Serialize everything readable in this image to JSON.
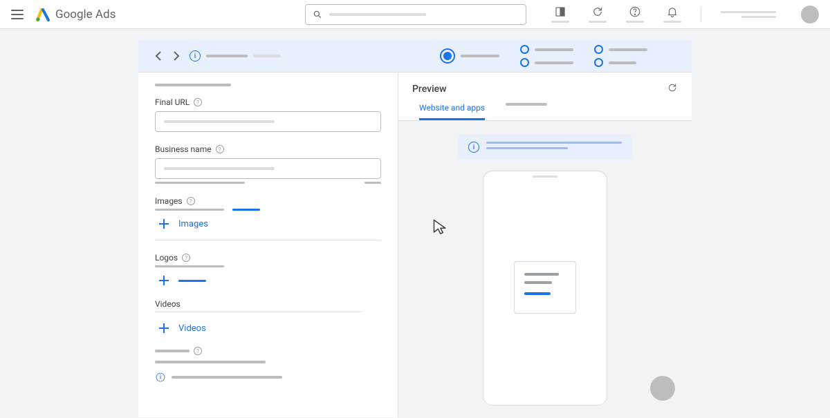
{
  "header": {
    "product_name_1": "Google",
    "product_name_2": "Ads"
  },
  "form": {
    "final_url_label": "Final URL",
    "business_name_label": "Business name",
    "images_label": "Images",
    "add_images_label": "Images",
    "logos_label": "Logos",
    "videos_label": "Videos",
    "add_videos_label": "Videos"
  },
  "preview": {
    "title": "Preview",
    "tab_active": "Website and apps"
  }
}
